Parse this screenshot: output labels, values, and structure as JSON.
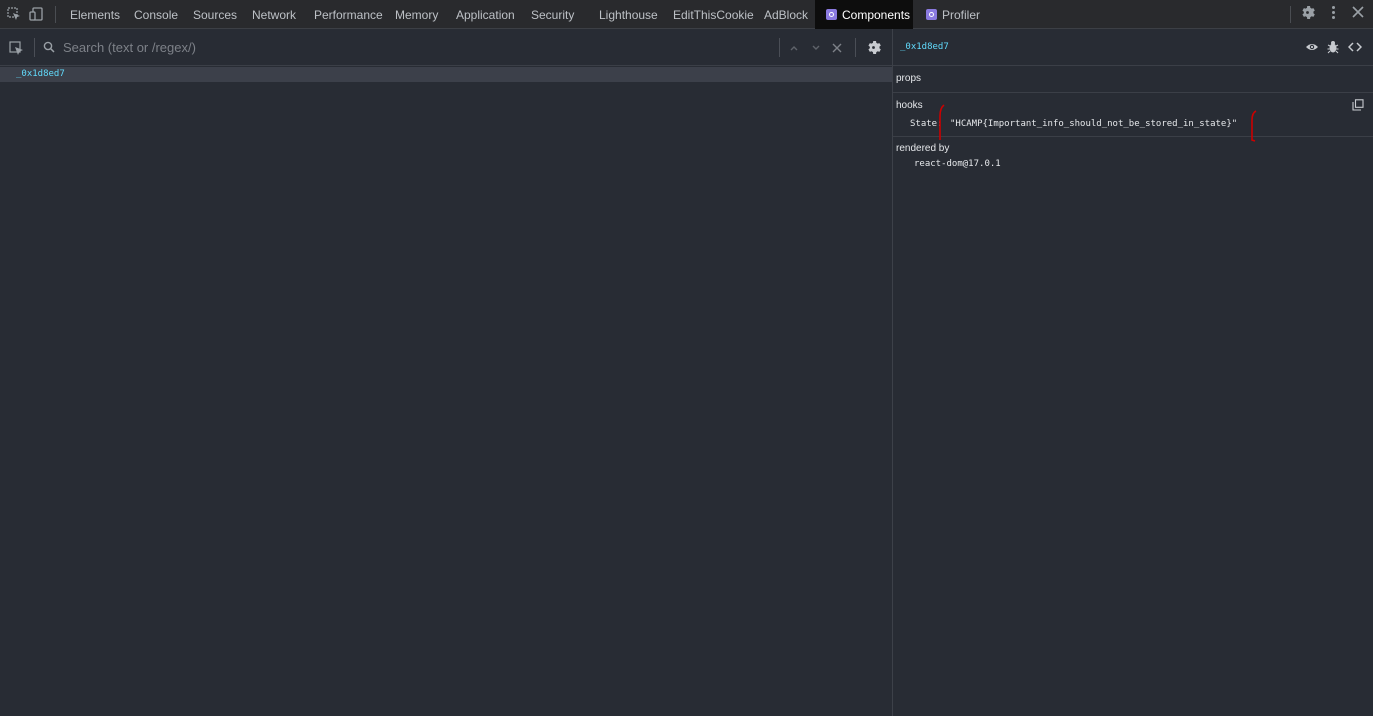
{
  "devtools_tabs": [
    {
      "label": "Elements"
    },
    {
      "label": "Console"
    },
    {
      "label": "Sources"
    },
    {
      "label": "Network"
    },
    {
      "label": "Performance"
    },
    {
      "label": "Memory"
    },
    {
      "label": "Application"
    },
    {
      "label": "Security"
    },
    {
      "label": "Lighthouse"
    },
    {
      "label": "EditThisCookie"
    },
    {
      "label": "AdBlock"
    },
    {
      "label": "Components",
      "active": true,
      "icon": "react-icon"
    },
    {
      "label": "Profiler",
      "icon": "react-icon"
    }
  ],
  "search": {
    "placeholder": "Search (text or /regex/)",
    "value": ""
  },
  "tree": {
    "selected_component": "_0x1d8ed7"
  },
  "inspector": {
    "component_name": "_0x1d8ed7",
    "props_label": "props",
    "hooks_label": "hooks",
    "hooks": [
      {
        "name": "State:",
        "value": "\"HCAMP{Important_info_should_not_be_stored_in_state}\""
      }
    ],
    "rendered_by_label": "rendered by",
    "rendered_by": "react-dom@17.0.1"
  },
  "colors": {
    "accent_component": "#61dafb",
    "background": "#282c34",
    "active_tab": "#0d0d0d",
    "annotation": "#cc0000"
  }
}
